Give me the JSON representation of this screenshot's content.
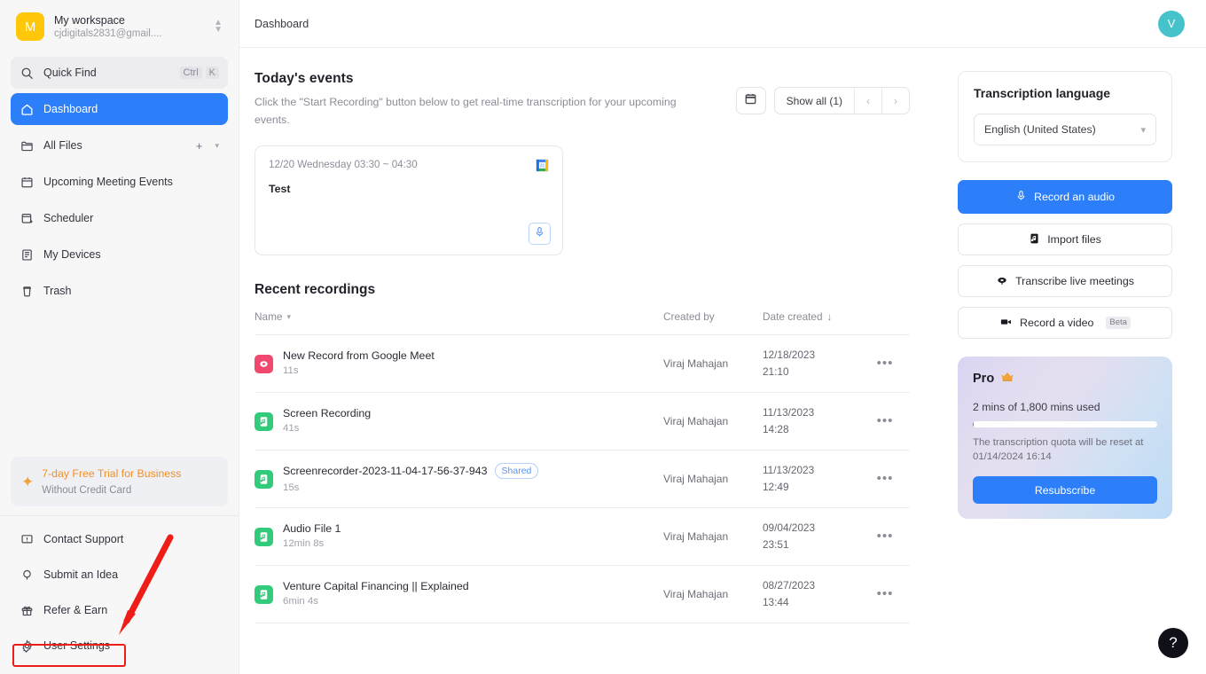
{
  "workspace": {
    "avatar_letter": "M",
    "avatar_color": "#ffc60a",
    "name": "My workspace",
    "email": "cjdigitals2831@gmail...."
  },
  "sidebar": {
    "quick_find": {
      "label": "Quick Find",
      "shortcut_mod": "Ctrl",
      "shortcut_key": "K"
    },
    "items": [
      {
        "label": "Dashboard",
        "icon": "home-icon",
        "active": true
      },
      {
        "label": "All Files",
        "icon": "folder-icon",
        "active": false
      },
      {
        "label": "Upcoming Meeting Events",
        "icon": "calendar-icon",
        "active": false
      },
      {
        "label": "Scheduler",
        "icon": "calendar-plus-icon",
        "active": false
      },
      {
        "label": "My Devices",
        "icon": "device-icon",
        "active": false
      },
      {
        "label": "Trash",
        "icon": "trash-icon",
        "active": false
      }
    ],
    "trial": {
      "title": "7-day Free Trial for Business",
      "subtitle": "Without Credit Card"
    },
    "bottom_items": [
      {
        "label": "Contact Support",
        "icon": "support-icon"
      },
      {
        "label": "Submit an Idea",
        "icon": "bulb-icon"
      },
      {
        "label": "Refer & Earn",
        "icon": "gift-icon"
      },
      {
        "label": "User Settings",
        "icon": "gear-icon"
      }
    ],
    "annotation": {
      "highlight_target": "User Settings",
      "color": "#ef1d17"
    }
  },
  "topbar": {
    "breadcrumb": "Dashboard",
    "avatar_letter": "V",
    "avatar_color": "#46c3ca"
  },
  "events": {
    "title": "Today's events",
    "subtitle": "Click the \"Start Recording\" button below to get real-time transcription for your upcoming events.",
    "calendar_button": "calendar-icon",
    "show_all_label": "Show all (1)",
    "prev_label": "‹",
    "next_label": "›",
    "cards": [
      {
        "time": "12/20 Wednesday 03:30 ~ 04:30",
        "name": "Test",
        "source": "google-calendar-icon"
      }
    ]
  },
  "recordings": {
    "title": "Recent recordings",
    "columns": {
      "name": "Name",
      "created_by": "Created by",
      "date_created": "Date created"
    },
    "sort": {
      "column": "Date created",
      "direction": "↓"
    },
    "rows": [
      {
        "name": "New Record from Google Meet",
        "duration": "11s",
        "created_by": "Viraj Mahajan",
        "date": "12/18/2023",
        "time": "21:10",
        "icon": "meet-record-icon",
        "icon_color": "#f0486f",
        "badge": ""
      },
      {
        "name": "Screen Recording",
        "duration": "41s",
        "created_by": "Viraj Mahajan",
        "date": "11/13/2023",
        "time": "14:28",
        "icon": "audio-file-icon",
        "icon_color": "#32cb7c",
        "badge": ""
      },
      {
        "name": "Screenrecorder-2023-11-04-17-56-37-943",
        "duration": "15s",
        "created_by": "Viraj Mahajan",
        "date": "11/13/2023",
        "time": "12:49",
        "icon": "audio-file-icon",
        "icon_color": "#32cb7c",
        "badge": "Shared"
      },
      {
        "name": "Audio File 1",
        "duration": "12min 8s",
        "created_by": "Viraj Mahajan",
        "date": "09/04/2023",
        "time": "23:51",
        "icon": "audio-file-icon",
        "icon_color": "#32cb7c",
        "badge": ""
      },
      {
        "name": "Venture Capital Financing || Explained",
        "duration": "6min 4s",
        "created_by": "Viraj Mahajan",
        "date": "08/27/2023",
        "time": "13:44",
        "icon": "audio-file-icon",
        "icon_color": "#32cb7c",
        "badge": ""
      }
    ],
    "row_menu_label": "•••"
  },
  "rail": {
    "language": {
      "title": "Transcription language",
      "selected": "English (United States)"
    },
    "actions": [
      {
        "label": "Record an audio",
        "icon": "microphone-icon",
        "primary": true,
        "badge": ""
      },
      {
        "label": "Import files",
        "icon": "audio-file-icon",
        "primary": false,
        "badge": ""
      },
      {
        "label": "Transcribe live meetings",
        "icon": "headset-icon",
        "primary": false,
        "badge": ""
      },
      {
        "label": "Record a video",
        "icon": "video-camera-icon",
        "primary": false,
        "badge": "Beta"
      }
    ],
    "pro": {
      "title": "Pro",
      "icon": "crown-icon",
      "quota": "2 mins of 1,800 mins used",
      "progress_percent": 0.5,
      "reset_note": "The transcription quota will be reset at 01/14/2024 16:14",
      "cta": "Resubscribe",
      "accent": "#2d7ff9"
    }
  },
  "help": {
    "label": "?"
  }
}
